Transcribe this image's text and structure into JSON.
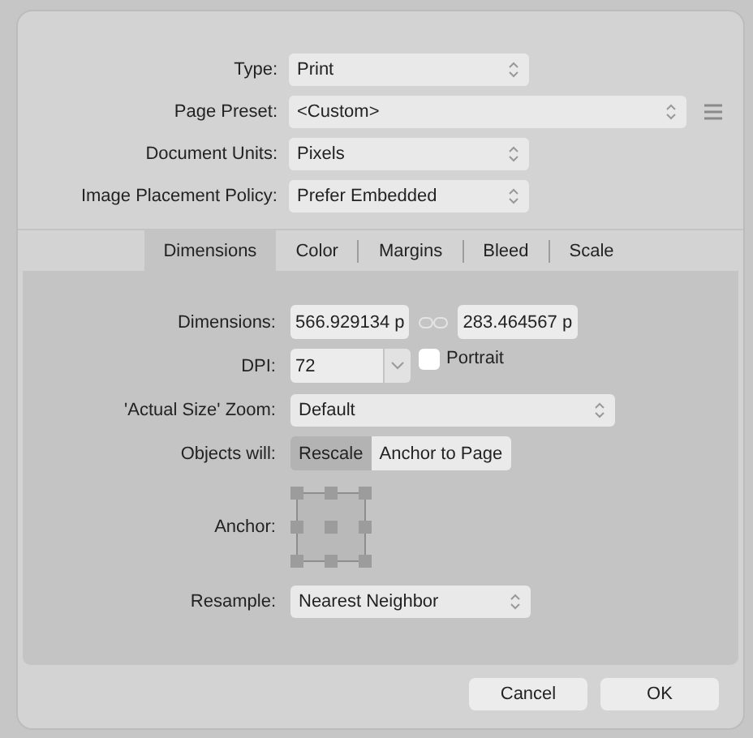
{
  "top_fields": [
    {
      "label": "Type:",
      "value": "Print",
      "wide": false,
      "menu": false
    },
    {
      "label": "Page Preset:",
      "value": "<Custom>",
      "wide": true,
      "menu": true
    },
    {
      "label": "Document Units:",
      "value": "Pixels",
      "wide": false,
      "menu": false
    },
    {
      "label": "Image Placement Policy:",
      "value": "Prefer Embedded",
      "wide": false,
      "menu": false
    }
  ],
  "tabs": [
    {
      "label": "Dimensions",
      "selected": true
    },
    {
      "label": "Color",
      "selected": false
    },
    {
      "label": "Margins",
      "selected": false
    },
    {
      "label": "Bleed",
      "selected": false
    },
    {
      "label": "Scale",
      "selected": false
    }
  ],
  "dimensions": {
    "label": "Dimensions:",
    "width": "566.929134 p",
    "height": "283.464567 p"
  },
  "dpi": {
    "label": "DPI:",
    "value": "72"
  },
  "portrait": {
    "label": "Portrait",
    "checked": false
  },
  "zoom": {
    "label": "'Actual Size' Zoom:",
    "value": "Default"
  },
  "objects": {
    "label": "Objects will:",
    "options": [
      {
        "label": "Rescale",
        "selected": true
      },
      {
        "label": "Anchor to Page",
        "selected": false
      }
    ]
  },
  "anchor": {
    "label": "Anchor:"
  },
  "resample": {
    "label": "Resample:",
    "value": "Nearest Neighbor"
  },
  "buttons": [
    "Cancel",
    "OK"
  ]
}
